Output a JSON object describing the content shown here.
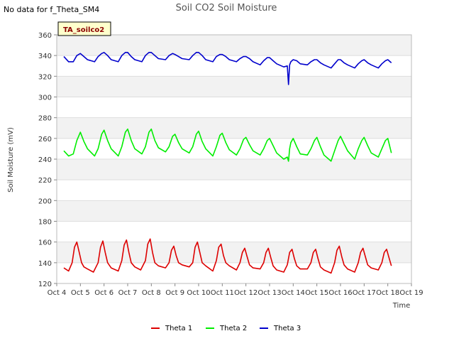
{
  "header": {
    "nodata_note": "No data for f_Theta_SM4"
  },
  "colors": {
    "theta1": "#dd0000",
    "theta2": "#00ee00",
    "theta3": "#0000cc",
    "band": "#f2f2f2",
    "grid": "#dddddd"
  },
  "chart_data": {
    "type": "line",
    "title": "Soil CO2 Soil Moisture",
    "xlabel": "Time",
    "ylabel": "Soil Moisture (mV)",
    "ylim": [
      120,
      360
    ],
    "xlim": [
      4,
      19
    ],
    "yticks": [
      120,
      140,
      160,
      180,
      200,
      220,
      240,
      260,
      280,
      300,
      320,
      340,
      360
    ],
    "xticks": [
      4,
      5,
      6,
      7,
      8,
      9,
      10,
      11,
      12,
      13,
      14,
      15,
      16,
      17,
      18,
      19
    ],
    "xtick_labels": [
      "Oct 4",
      "Oct 5",
      "Oct 6",
      "Oct 7",
      "Oct 8",
      "Oct 9",
      "Oct 10",
      "Oct 11",
      "Oct 12",
      "Oct 13",
      "Oct 14",
      "Oct 15",
      "Oct 16",
      "Oct 17",
      "Oct 18",
      "Oct 19"
    ],
    "grid": true,
    "legend_position": "bottom-center",
    "badge": "TA_soilco2",
    "series": [
      {
        "name": "Theta 1",
        "color": "#dd0000",
        "x": [
          4.3,
          4.5,
          4.65,
          4.75,
          4.85,
          4.95,
          5.05,
          5.15,
          5.3,
          5.55,
          5.75,
          5.85,
          5.95,
          6.05,
          6.15,
          6.3,
          6.6,
          6.75,
          6.85,
          6.95,
          7.05,
          7.15,
          7.3,
          7.55,
          7.75,
          7.85,
          7.95,
          8.05,
          8.15,
          8.3,
          8.6,
          8.75,
          8.85,
          8.95,
          9.05,
          9.15,
          9.3,
          9.6,
          9.75,
          9.85,
          9.95,
          10.05,
          10.15,
          10.3,
          10.6,
          10.75,
          10.85,
          10.95,
          11.05,
          11.15,
          11.3,
          11.6,
          11.75,
          11.85,
          11.95,
          12.05,
          12.15,
          12.3,
          12.6,
          12.75,
          12.85,
          12.95,
          13.05,
          13.15,
          13.3,
          13.6,
          13.75,
          13.85,
          13.95,
          14.05,
          14.15,
          14.3,
          14.6,
          14.75,
          14.85,
          14.95,
          15.05,
          15.15,
          15.3,
          15.6,
          15.75,
          15.85,
          15.95,
          16.05,
          16.15,
          16.3,
          16.6,
          16.75,
          16.85,
          16.95,
          17.05,
          17.15,
          17.3,
          17.6,
          17.75,
          17.85,
          17.95,
          18.05,
          18.15
        ],
        "values": [
          135,
          132,
          140,
          155,
          160,
          150,
          140,
          136,
          134,
          131,
          140,
          155,
          161,
          150,
          140,
          135,
          132,
          142,
          157,
          162,
          150,
          140,
          136,
          133,
          142,
          158,
          163,
          150,
          140,
          137,
          135,
          140,
          152,
          156,
          147,
          140,
          138,
          136,
          140,
          155,
          160,
          150,
          140,
          137,
          132,
          142,
          155,
          158,
          147,
          140,
          137,
          133,
          140,
          150,
          154,
          146,
          138,
          135,
          134,
          140,
          150,
          154,
          145,
          137,
          133,
          131,
          138,
          150,
          153,
          144,
          137,
          134,
          134,
          140,
          150,
          153,
          144,
          136,
          133,
          130,
          140,
          152,
          156,
          146,
          138,
          134,
          131,
          140,
          150,
          154,
          146,
          138,
          135,
          133,
          140,
          150,
          153,
          145,
          137
        ]
      },
      {
        "name": "Theta 2",
        "color": "#00ee00",
        "x": [
          4.3,
          4.5,
          4.7,
          4.85,
          5.0,
          5.15,
          5.3,
          5.6,
          5.75,
          5.9,
          6.0,
          6.15,
          6.3,
          6.6,
          6.75,
          6.9,
          7.0,
          7.15,
          7.3,
          7.6,
          7.75,
          7.9,
          8.0,
          8.15,
          8.3,
          8.6,
          8.75,
          8.9,
          9.0,
          9.15,
          9.3,
          9.6,
          9.75,
          9.9,
          10.0,
          10.15,
          10.3,
          10.6,
          10.75,
          10.9,
          11.0,
          11.15,
          11.3,
          11.6,
          11.75,
          11.9,
          12.0,
          12.15,
          12.3,
          12.6,
          12.75,
          12.9,
          13.0,
          13.15,
          13.3,
          13.6,
          13.75,
          13.8,
          13.85,
          13.9,
          14.0,
          14.15,
          14.3,
          14.6,
          14.75,
          14.9,
          15.0,
          15.15,
          15.3,
          15.6,
          15.75,
          15.9,
          16.0,
          16.15,
          16.3,
          16.6,
          16.75,
          16.9,
          17.0,
          17.15,
          17.3,
          17.6,
          17.75,
          17.9,
          18.0,
          18.15
        ],
        "values": [
          248,
          243,
          245,
          258,
          266,
          257,
          250,
          243,
          250,
          264,
          268,
          258,
          250,
          243,
          252,
          266,
          269,
          258,
          250,
          245,
          252,
          266,
          269,
          258,
          251,
          247,
          252,
          262,
          264,
          256,
          250,
          246,
          252,
          264,
          267,
          257,
          250,
          243,
          252,
          263,
          265,
          256,
          249,
          244,
          250,
          259,
          261,
          254,
          248,
          244,
          250,
          258,
          260,
          253,
          246,
          240,
          242,
          238,
          250,
          256,
          260,
          252,
          245,
          244,
          250,
          258,
          261,
          252,
          244,
          238,
          248,
          258,
          262,
          255,
          248,
          240,
          250,
          258,
          261,
          253,
          246,
          242,
          250,
          258,
          260,
          246
        ]
      },
      {
        "name": "Theta 3",
        "color": "#0000cc",
        "x": [
          4.3,
          4.5,
          4.7,
          4.85,
          5.0,
          5.15,
          5.3,
          5.6,
          5.75,
          5.9,
          6.0,
          6.15,
          6.3,
          6.6,
          6.75,
          6.9,
          7.0,
          7.15,
          7.3,
          7.6,
          7.75,
          7.9,
          8.0,
          8.15,
          8.3,
          8.6,
          8.75,
          8.9,
          9.0,
          9.15,
          9.3,
          9.6,
          9.75,
          9.9,
          10.0,
          10.15,
          10.3,
          10.6,
          10.75,
          10.9,
          11.0,
          11.15,
          11.3,
          11.6,
          11.75,
          11.9,
          12.0,
          12.15,
          12.3,
          12.6,
          12.75,
          12.9,
          13.0,
          13.15,
          13.3,
          13.6,
          13.75,
          13.8,
          13.85,
          13.9,
          14.0,
          14.15,
          14.3,
          14.6,
          14.75,
          14.9,
          15.0,
          15.15,
          15.3,
          15.6,
          15.75,
          15.9,
          16.0,
          16.15,
          16.3,
          16.6,
          16.75,
          16.9,
          17.0,
          17.15,
          17.3,
          17.6,
          17.75,
          17.9,
          18.0,
          18.15
        ],
        "values": [
          339,
          334,
          334,
          340,
          342,
          339,
          336,
          334,
          339,
          342,
          343,
          340,
          336,
          334,
          340,
          343,
          343,
          339,
          336,
          334,
          340,
          343,
          343,
          340,
          337,
          336,
          340,
          342,
          341,
          339,
          337,
          336,
          340,
          343,
          343,
          340,
          336,
          334,
          339,
          341,
          341,
          339,
          336,
          334,
          337,
          339,
          339,
          337,
          334,
          331,
          335,
          338,
          338,
          335,
          332,
          329,
          330,
          312,
          331,
          334,
          336,
          335,
          332,
          331,
          334,
          336,
          336,
          333,
          331,
          328,
          332,
          336,
          336,
          333,
          331,
          328,
          332,
          335,
          336,
          333,
          331,
          328,
          332,
          335,
          336,
          333
        ]
      }
    ]
  }
}
